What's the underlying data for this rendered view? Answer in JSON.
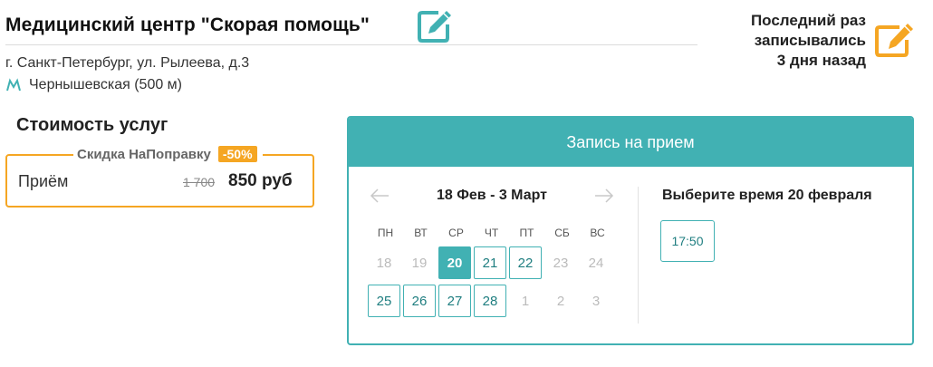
{
  "clinic": {
    "title": "Медицинский центр \"Скорая помощь\"",
    "address": "г. Санкт-Петербург, ул. Рылеева, д.3",
    "metro": "Чернышевская (500 м)",
    "metro_icon": "metro-icon",
    "edit_icon": "edit-icon"
  },
  "last_visit": {
    "line1": "Последний раз",
    "line2": "записывались",
    "line3": "3 дня назад",
    "icon": "edit-icon"
  },
  "prices": {
    "title": "Стоимость услуг",
    "discount_label": "Скидка НаПоправку",
    "discount_badge": "-50%",
    "service_name": "Приём",
    "price_old": "1 700",
    "price_new": "850 руб"
  },
  "booking": {
    "header": "Запись на прием",
    "date_range": "18 Фев - 3 Март",
    "weekdays": [
      "ПН",
      "ВТ",
      "СР",
      "ЧТ",
      "ПТ",
      "СБ",
      "ВС"
    ],
    "days": [
      "18",
      "19",
      "20",
      "21",
      "22",
      "23",
      "24",
      "25",
      "26",
      "27",
      "28",
      "1",
      "2",
      "3"
    ],
    "time_title": "Выберите время 20 февраля",
    "time_slot": "17:50"
  },
  "colors": {
    "accent": "#41b1b3",
    "discount": "#f5a623"
  }
}
